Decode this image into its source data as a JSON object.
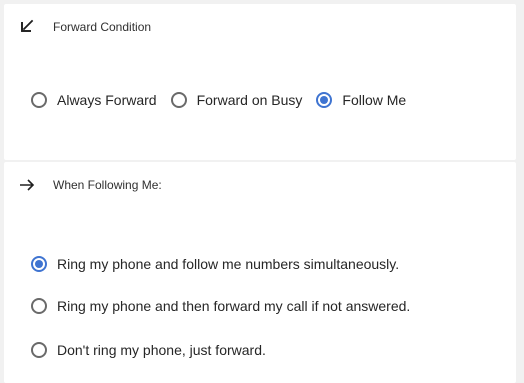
{
  "forward_condition": {
    "header_icon": "arrow-down-left-icon",
    "title": "Forward Condition",
    "options": [
      {
        "label": "Always Forward",
        "checked": false
      },
      {
        "label": "Forward on Busy",
        "checked": false
      },
      {
        "label": "Follow Me",
        "checked": true
      }
    ]
  },
  "follow_me": {
    "header_icon": "arrow-right-icon",
    "title": "When Following Me:",
    "options": [
      {
        "label": "Ring my phone and follow me numbers simultaneously.",
        "checked": true
      },
      {
        "label": "Ring my phone and then forward my call if not answered.",
        "checked": false
      },
      {
        "label": "Don't ring my phone, just forward.",
        "checked": false
      }
    ]
  },
  "colors": {
    "accent": "#3f74d1",
    "background": "#f1f1f1",
    "card": "#ffffff"
  }
}
